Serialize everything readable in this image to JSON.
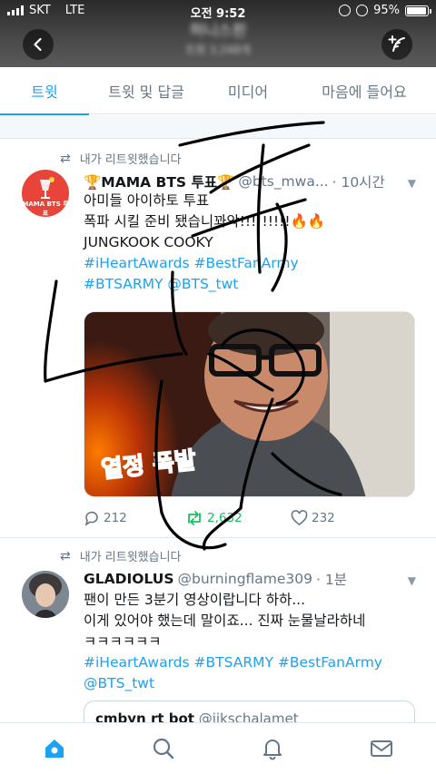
{
  "status_bar": {
    "carrier": "SKT",
    "network": "LTE",
    "time": "오전 9:52",
    "battery": "95%",
    "battery_level": 0.95
  },
  "header": {
    "title_blurred": "허니스핀",
    "subtitle_blurred": "트윗 3,248개"
  },
  "tabs": [
    {
      "label": "트윗",
      "active": true
    },
    {
      "label": "트윗 및 답글",
      "active": false
    },
    {
      "label": "미디어",
      "active": false
    },
    {
      "label": "마음에 들어요",
      "active": false
    }
  ],
  "tweets": [
    {
      "retweet_label": "내가 리트윗했습니다",
      "avatar_text": "MAMA BTS 투표",
      "name": "🏆MAMA BTS 투표🏆",
      "handle": "@bts_mwa...",
      "time": "· 10시간",
      "lines": [
        "아미들 아이하토 투표",
        "폭파 시킬 준비 됐습니꽈악!!!!!!!!!🔥🔥",
        "JUNGKOOK COOKY"
      ],
      "hashtag_lines": [
        "#iHeartAwards #BestFanArmy",
        "#BTSARMY @BTS_twt"
      ],
      "media_caption": "열정 폭발",
      "replies": "212",
      "retweets": "2,632",
      "likes": "232"
    },
    {
      "retweet_label": "내가 리트윗했습니다",
      "name": "GLADIOLUS",
      "handle": "@burningflame309",
      "time": "· 1분",
      "lines": [
        "팬이 만든 3분기 영상이랍니다 하하...",
        "이게 있어야 했는데 말이죠... 진짜 눈물날라하네",
        "ㅋㅋㅋㅋㅋㅋ"
      ],
      "hashtag_lines": [
        "#iHeartAwards #BTSARMY #BestFanArmy",
        "@BTS_twt"
      ],
      "quote_name": "cmbyn rt bot",
      "quote_handle": "@jikschalamet"
    }
  ],
  "bottom_nav": [
    {
      "icon": "home-icon",
      "active": true
    },
    {
      "icon": "search-icon",
      "active": false
    },
    {
      "icon": "bell-icon",
      "active": false
    },
    {
      "icon": "mail-icon",
      "active": false
    }
  ],
  "colors": {
    "accent": "#1da1f2",
    "retweet_green": "#17bf63",
    "muted": "#657786",
    "avatar_red": "#e8443a"
  }
}
